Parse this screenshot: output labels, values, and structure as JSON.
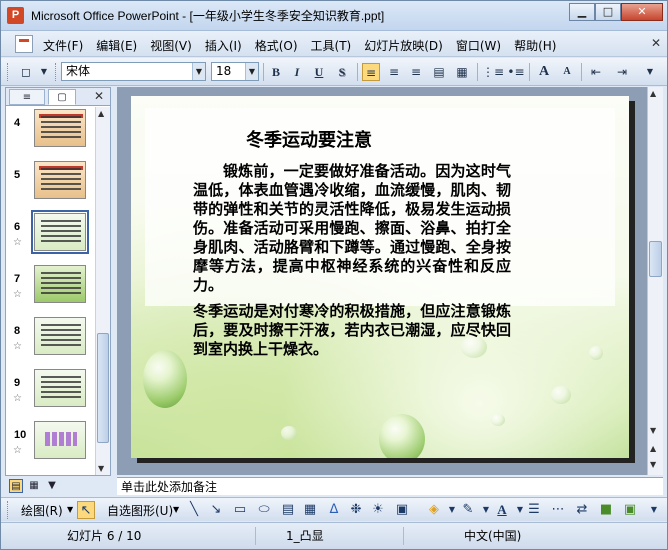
{
  "window": {
    "title": "Microsoft Office PowerPoint - [一年级小学生冬季安全知识教育.ppt]",
    "app_icon_letter": "P",
    "min_glyph": "▁",
    "max_glyph": "□",
    "close_glyph": "✕"
  },
  "menu": {
    "items": [
      "文件(F)",
      "编辑(E)",
      "视图(V)",
      "插入(I)",
      "格式(O)",
      "工具(T)",
      "幻灯片放映(D)",
      "窗口(W)",
      "帮助(H)"
    ],
    "close_glyph": "✕"
  },
  "toolbar": {
    "font_name": "宋体",
    "font_size": "18",
    "bold": "B",
    "italic": "I",
    "underline": "U",
    "shadow": "S",
    "grow_font": "A",
    "shrink_font": "A"
  },
  "slide_pane": {
    "close_glyph": "✕",
    "thumbnails": [
      {
        "number": "4",
        "star": ""
      },
      {
        "number": "5",
        "star": ""
      },
      {
        "number": "6",
        "star": "☆"
      },
      {
        "number": "7",
        "star": "☆"
      },
      {
        "number": "8",
        "star": "☆"
      },
      {
        "number": "9",
        "star": "☆"
      },
      {
        "number": "10",
        "star": "☆"
      }
    ]
  },
  "slide": {
    "title": "冬季运动要注意",
    "paragraph1": "锻炼前，一定要做好准备活动。因为这时气温低，体表血管遇冷收缩，血流缓慢，肌肉、韧带的弹性和关节的灵活性降低，极易发生运动损伤。准备活动可采用慢跑、擦面、浴鼻、拍打全身肌肉、活动胳臂和下蹲等。通过慢跑、全身按摩等方法，提高中枢神经系统的兴奋性和反应力。",
    "paragraph2": "冬季运动是对付寒冷的积极措施，但应注意锻炼后，要及时擦干汗液，若内衣已潮湿，应尽快回到室内换上干燥衣。"
  },
  "notes": {
    "placeholder": "单击此处添加备注"
  },
  "drawing": {
    "draw_label": "绘图(R)",
    "autoshape_label": "自选图形(U)"
  },
  "status": {
    "slide_position": "幻灯片 6 / 10",
    "design": "1_凸显",
    "language": "中文(中国)"
  },
  "colors": {
    "accent": "#3b63a6",
    "title_bar": "#c3d6ee",
    "close_button": "#c7452e"
  }
}
